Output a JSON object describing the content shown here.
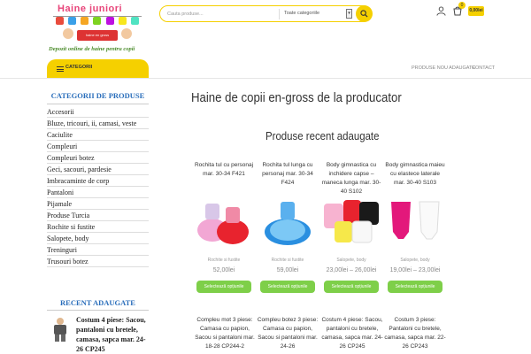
{
  "header": {
    "logo_title": "Haine juniori",
    "logo_sign": "haine en gross",
    "tagline": "Depozit online de haine pentru copii",
    "search_placeholder": "Cauta produse...",
    "category_select": "Toate categoriile",
    "select_arrow": "▾",
    "cart_count": "0",
    "cart_total": "0,00lei",
    "accent_color": "#f5d000"
  },
  "nav": {
    "categories_label": "CATEGORII",
    "links": [
      "PRODUSE NOU ADAUGATE",
      "CONTACT"
    ]
  },
  "sidebar": {
    "heading": "CATEGORII DE PRODUSE",
    "items": [
      "Accesorii",
      "Bluze, tricouri, ii, camasi, veste",
      "Caciulite",
      "Compleuri",
      "Compleuri botez",
      "Geci, sacouri, pardesie",
      "Imbracaminte de corp",
      "Pantaloni",
      "Pijamale",
      "Produse Turcia",
      "Rochite si fustite",
      "Salopete, body",
      "Treninguri",
      "Trusouri botez"
    ],
    "recent_heading": "RECENT ADAUGATE",
    "recent_item": "Costum 4 piese: Sacou, pantaloni cu bretele, camasa, sapca mar. 24-26 CP245"
  },
  "main": {
    "page_title": "Haine de copii en-gross de la producator",
    "section_title": "Produse recent adaugate",
    "products": [
      {
        "title": "Rochita tul cu personaj mar. 30-34 F421",
        "category": "Rochite si fustite",
        "price": "52,00lei",
        "button": "Selectează opțiunile"
      },
      {
        "title": "Rochita tul lunga cu personaj mar. 30-34 F424",
        "category": "Rochite si fustite",
        "price": "59,00lei",
        "button": "Selectează opțiunile"
      },
      {
        "title": "Body gimnastica cu inchidere capse – maneca lunga mar. 30-40 S102",
        "category": "Salopete, body",
        "price": "23,00lei – 26,00lei",
        "button": "Selectează opțiunile"
      },
      {
        "title": "Body gimnastica maieu cu elastece laterale mar. 30-40 S103",
        "category": "Salopete, body",
        "price": "19,00lei – 23,00lei",
        "button": "Selectează opțiunile"
      }
    ],
    "products_row2": [
      "Compleu mot 3 piese: Camasa cu papion, Sacou si pantaloni mar. 18-28 CP244-2",
      "Compleu botez 3 piese: Camasa cu papion, Sacou si pantaloni mar. 24-26",
      "Costum 4 piese: Sacou, pantaloni cu bretele, camasa, sapca mar. 24-26 CP245",
      "Costum 3 piese: Pantaloni cu bretele, camasa, sapca mar. 22-26 CP243"
    ]
  }
}
